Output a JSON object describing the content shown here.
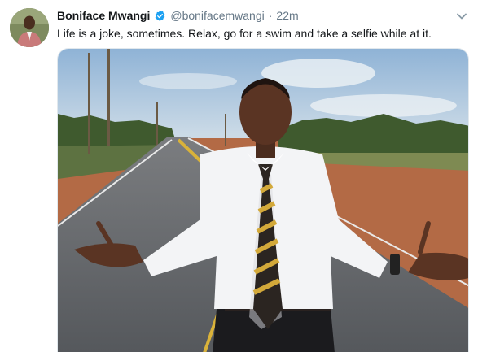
{
  "tweet": {
    "display_name": "Boniface Mwangi",
    "handle": "@bonifacemwangi",
    "separator": "·",
    "time": "22m",
    "text": "Life is a joke, sometimes. Relax, go for a swim and take a selfie while at it."
  },
  "icons": {
    "verified": "verified-badge-icon",
    "menu": "chevron-down-icon"
  },
  "colors": {
    "name": "#14171a",
    "secondary": "#657786",
    "verified": "#1da1f2",
    "divider": "#e1e8ed"
  }
}
